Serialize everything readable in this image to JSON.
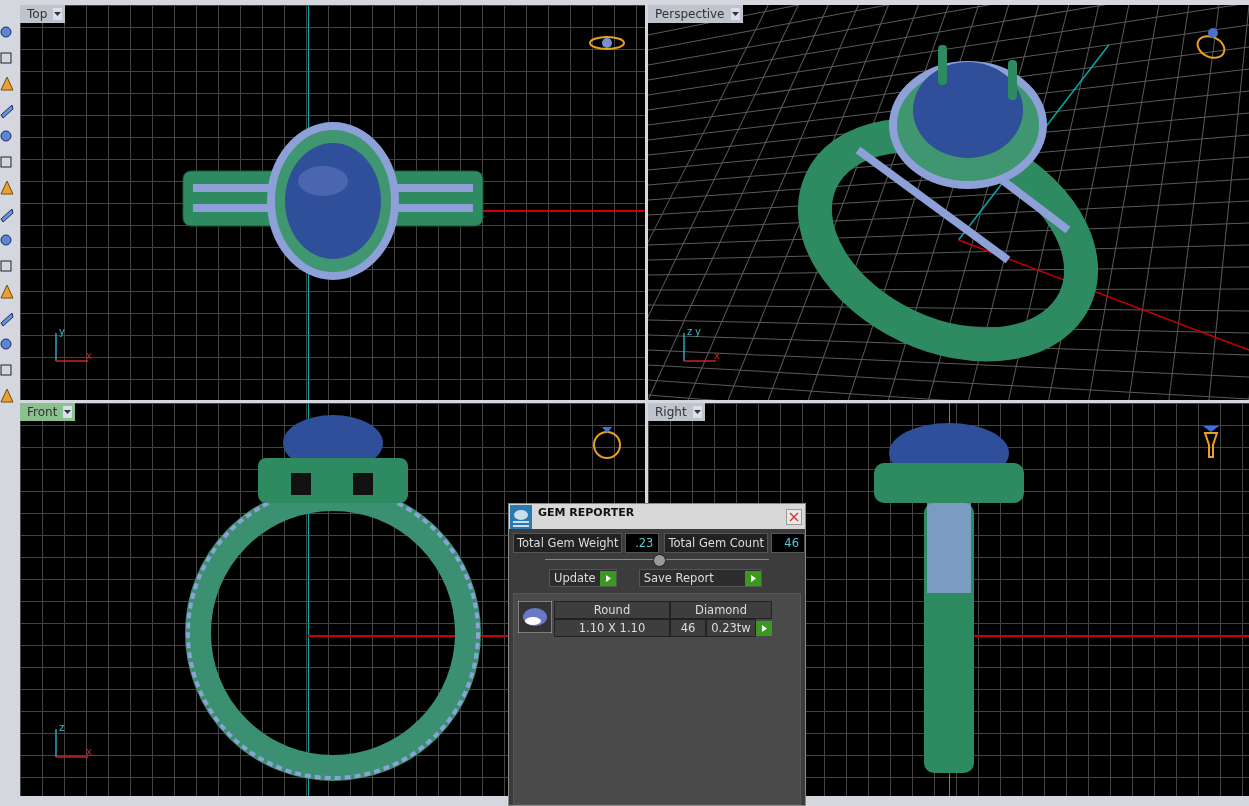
{
  "viewports": [
    {
      "label": "Top",
      "kind": "top",
      "selected": false,
      "axes": [
        "y",
        "x"
      ]
    },
    {
      "label": "Perspective",
      "kind": "perspective",
      "selected": false,
      "axes": [
        "z",
        "y",
        "x"
      ]
    },
    {
      "label": "Front",
      "kind": "front",
      "selected": true,
      "axes": [
        "z",
        "x"
      ]
    },
    {
      "label": "Right",
      "kind": "right",
      "selected": false
    }
  ],
  "gem_reporter": {
    "title": "GEM REPORTER",
    "weight_label": "Total Gem Weight",
    "weight": ".23",
    "count_label": "Total Gem Count",
    "count": "46",
    "buttons": [
      "Update",
      "Save Report"
    ],
    "rows": [
      {
        "shape": "Round",
        "type": "Diamond",
        "size": "1.10 X 1.10",
        "count": "46",
        "weight": "0.23tw"
      }
    ]
  }
}
